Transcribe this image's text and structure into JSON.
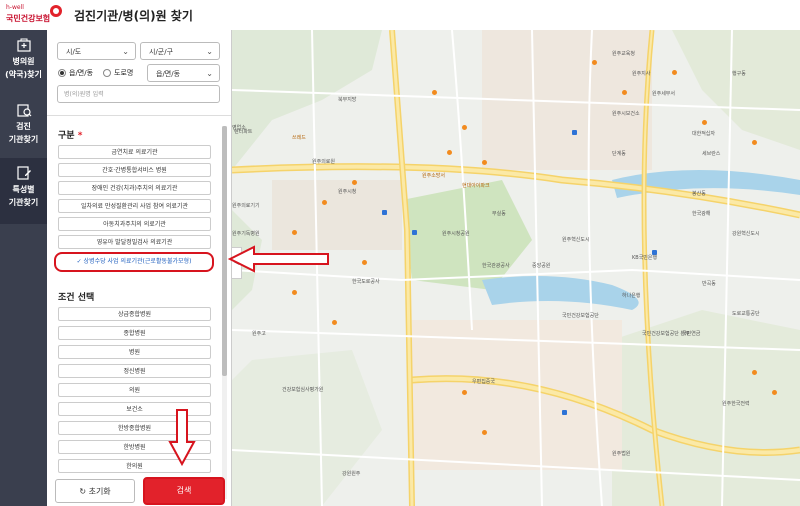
{
  "header": {
    "logo_small": "h-well",
    "logo_main": "국민건강보험",
    "title": "검진기관/병(의)원 찾기"
  },
  "leftnav": {
    "items": [
      {
        "label1": "병의원",
        "label2": "(약국)찾기"
      },
      {
        "label1": "검진",
        "label2": "기관찾기"
      },
      {
        "label1": "특성별",
        "label2": "기관찾기"
      }
    ]
  },
  "filters": {
    "sido": "시/도",
    "sigungu": "시/군/구",
    "radio_1": "읍/면/동",
    "radio_2": "도로명",
    "emd": "읍/면/동",
    "search_placeholder": "병(의)원명 입력"
  },
  "category": {
    "title": "구분",
    "required_mark": "*",
    "options": [
      "금연치료 의료기관",
      "간호·간병통합서비스 병원",
      "장애인 건강(치과)주치의 의료기관",
      "일차의료 만성질환관리 사업 참여 의료기관",
      "아동치과주치의 의료기관",
      "영유아 발달정밀검사 의료기관",
      "상병수당 사업 의료기관(근로활동불가모형)"
    ],
    "checkmark": "✓"
  },
  "conditions": {
    "title": "조건 선택",
    "options": [
      "상급종합병원",
      "종합병원",
      "병원",
      "정신병원",
      "의원",
      "보건소",
      "한방종합병원",
      "한방병원",
      "한의원"
    ]
  },
  "buttons": {
    "reset": "초기화",
    "reset_icon": "refresh-icon",
    "search": "검색"
  },
  "map_labels": [
    "북부지방",
    "쓰레드",
    "영업소",
    "렌터파트",
    "원주의료원",
    "원주소방서",
    "현대아이파크",
    "원주시청",
    "무실동",
    "원주시청공원",
    "한국도로공사",
    "한국관광공사",
    "원주혁신도시",
    "국민건강보험공단",
    "건강보험심사평가원",
    "우편집중국",
    "원주지사",
    "중앙공원",
    "행구동",
    "반곡동",
    "봉산동",
    "단계동",
    "국민연금",
    "원주고",
    "한국광해",
    "KB국민은행",
    "하나은행",
    "원주세무서",
    "대한적십자",
    "원주교육청",
    "원주시보건소",
    "강원혁신도시",
    "국민건강보험공단 본부",
    "세브란스",
    "원주한국전력",
    "도로교통공단",
    "원주기독병원",
    "원주의료기기",
    "강원원주",
    "원주법원"
  ],
  "colors": {
    "accent_red": "#e2222b",
    "nav_bg": "#3a3f4e",
    "checked_text": "#1f5fbf",
    "annotation_red": "#d7141e"
  }
}
